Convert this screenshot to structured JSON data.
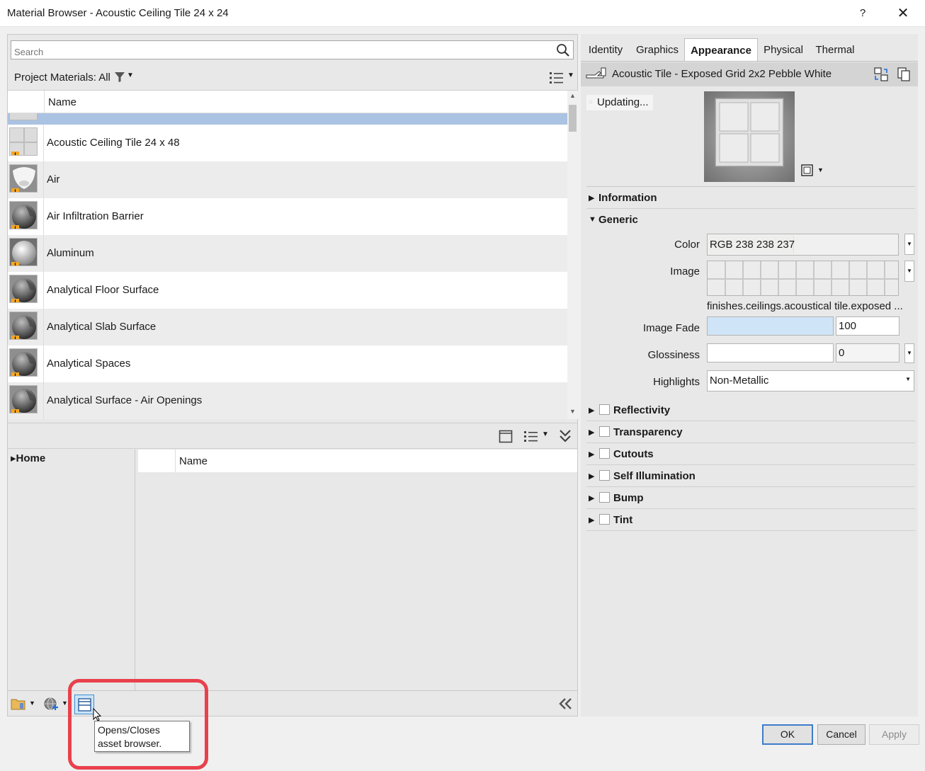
{
  "window": {
    "title": "Material Browser - Acoustic Ceiling Tile 24 x 24",
    "help": "?",
    "close": "✕"
  },
  "search": {
    "placeholder": "Search"
  },
  "project_bar": {
    "label": "Project Materials: All"
  },
  "material_list": {
    "header_name": "Name",
    "items": [
      {
        "name": "Acoustic Ceiling Tile 24 x 48",
        "thumb": "tile"
      },
      {
        "name": "Air",
        "thumb": "air"
      },
      {
        "name": "Air Infiltration Barrier",
        "thumb": "sphere-dark"
      },
      {
        "name": "Aluminum",
        "thumb": "sphere-light"
      },
      {
        "name": "Analytical Floor Surface",
        "thumb": "sphere-dark"
      },
      {
        "name": "Analytical Slab Surface",
        "thumb": "sphere-dark"
      },
      {
        "name": "Analytical Spaces",
        "thumb": "sphere-dark"
      },
      {
        "name": "Analytical Surface - Air Openings",
        "thumb": "sphere-dark"
      }
    ],
    "warning_glyph": "!"
  },
  "asset_browser": {
    "home_label": "Home",
    "header_name": "Name",
    "tooltip": "Opens/Closes asset browser."
  },
  "tabs": [
    {
      "label": "Identity",
      "active": false
    },
    {
      "label": "Graphics",
      "active": false
    },
    {
      "label": "Appearance",
      "active": true
    },
    {
      "label": "Physical",
      "active": false
    },
    {
      "label": "Thermal",
      "active": false
    }
  ],
  "appearance": {
    "asset_name": "Acoustic Tile - Exposed Grid 2x2 Pebble White",
    "status": "Updating...",
    "sections_top": [
      {
        "label": "Information",
        "expanded": false
      },
      {
        "label": "Generic",
        "expanded": true
      }
    ],
    "generic": {
      "color_label": "Color",
      "color_value": "RGB 238 238 237",
      "image_label": "Image",
      "image_path": "finishes.ceilings.acoustical tile.exposed ...",
      "image_fade_label": "Image Fade",
      "image_fade_value": "100",
      "glossiness_label": "Glossiness",
      "glossiness_value": "0",
      "highlights_label": "Highlights",
      "highlights_value": "Non-Metallic"
    },
    "sections_bottom": [
      {
        "label": "Reflectivity",
        "enabled": false
      },
      {
        "label": "Transparency",
        "enabled": false
      },
      {
        "label": "Cutouts",
        "enabled": false
      },
      {
        "label": "Self Illumination",
        "enabled": false
      },
      {
        "label": "Bump",
        "enabled": false
      },
      {
        "label": "Tint",
        "enabled": false
      }
    ]
  },
  "buttons": {
    "ok": "OK",
    "cancel": "Cancel",
    "apply": "Apply"
  },
  "colors": {
    "selection": "#abc3e2",
    "highlight_box": "#e8414c",
    "warning": "#f5a623",
    "ok_border": "#3d7cc9"
  }
}
